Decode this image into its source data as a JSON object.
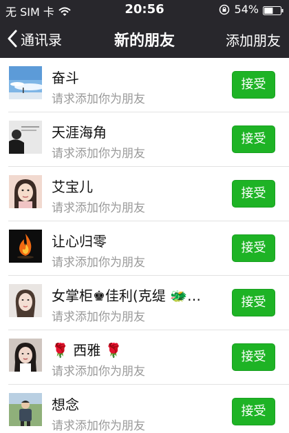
{
  "status_bar": {
    "carrier": "无 SIM 卡",
    "time": "20:56",
    "battery_percent": "54%",
    "battery_level": 0.54,
    "icons": [
      "wifi-icon",
      "rotation-lock-icon",
      "battery-icon"
    ]
  },
  "nav": {
    "back_label": "通讯录",
    "title": "新的朋友",
    "right_action": "添加朋友"
  },
  "colors": {
    "header_bg": "#28272c",
    "accept_green": "#1eb325",
    "subtitle_gray": "#9a9a9a"
  },
  "friend_requests": [
    {
      "name": "奋斗",
      "message": "请求添加你为朋友",
      "action": "接受",
      "avatar_icon": "sky-photo-avatar"
    },
    {
      "name": "天涯海角",
      "message": "请求添加你为朋友",
      "action": "接受",
      "avatar_icon": "person-photo-avatar"
    },
    {
      "name": "艾宝儿",
      "message": "请求添加你为朋友",
      "action": "接受",
      "avatar_icon": "girl-photo-avatar"
    },
    {
      "name": "让心归零",
      "message": "请求添加你为朋友",
      "action": "接受",
      "avatar_icon": "fire-avatar"
    },
    {
      "name": "女掌柜♚佳利(克缇 🐲…",
      "message": "请求添加你为朋友",
      "action": "接受",
      "avatar_icon": "woman-photo-avatar"
    },
    {
      "name": "🌹 西雅 🌹",
      "message": "请求添加你为朋友",
      "action": "接受",
      "avatar_icon": "woman-photo-avatar"
    },
    {
      "name": "想念",
      "message": "请求添加你为朋友",
      "action": "接受",
      "avatar_icon": "man-photo-avatar"
    }
  ]
}
